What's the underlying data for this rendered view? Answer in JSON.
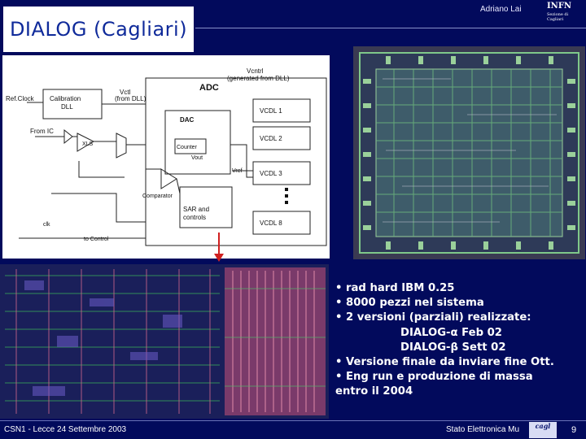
{
  "header": {
    "title": "DIALOG (Cagliari)",
    "author": "Adriano Lai",
    "logo_text": "INFN",
    "logo_sub": "Sezione di Cagliari"
  },
  "diagram": {
    "ref_clock": "Ref.Clock",
    "calib_dll": "Calibration\nDLL",
    "vctl": "Vctl",
    "vctl_sub": "(from DLL)",
    "vcntrl_adc": "Vcntrl",
    "vcntrl_sub": "(generated from DLL)",
    "adc": "ADC",
    "dac": "DAC",
    "from_ic": "From IC",
    "xls": "XLS",
    "vcdl": [
      "VCDL 1",
      "VCDL 2",
      "VCDL 3",
      "VCDL 8"
    ],
    "counter": "Counter",
    "vout": "Vout",
    "vref": "Vref",
    "comparator": "Comparator",
    "sar": "SAR and\ncontrols",
    "clk": "clk",
    "bottom": "to Control"
  },
  "bullets": {
    "b1": "• rad hard IBM 0.25",
    "b2": "• 8000 pezzi nel sistema",
    "b3": "• 2 versioni (parziali) realizzate:",
    "b4": "DIALOG-α Feb 02",
    "b5": "DIALOG-β Sett 02",
    "b6": "• Versione finale da inviare fine Ott.",
    "b7": "• Eng run e produzione di massa",
    "b8": "entro il 2004"
  },
  "footer": {
    "left": "CSN1 - Lecce 24 Settembre 2003",
    "mid": "Stato Elettronica Mu",
    "logo": "cagl",
    "page": "9"
  },
  "colors": {
    "background": "#020a5c",
    "title_text": "#0f2a9a",
    "chip_frame": "#3a3a52",
    "chip_trace": "#68b878",
    "layout_trace": "#c86488",
    "arrow": "#d02020"
  }
}
